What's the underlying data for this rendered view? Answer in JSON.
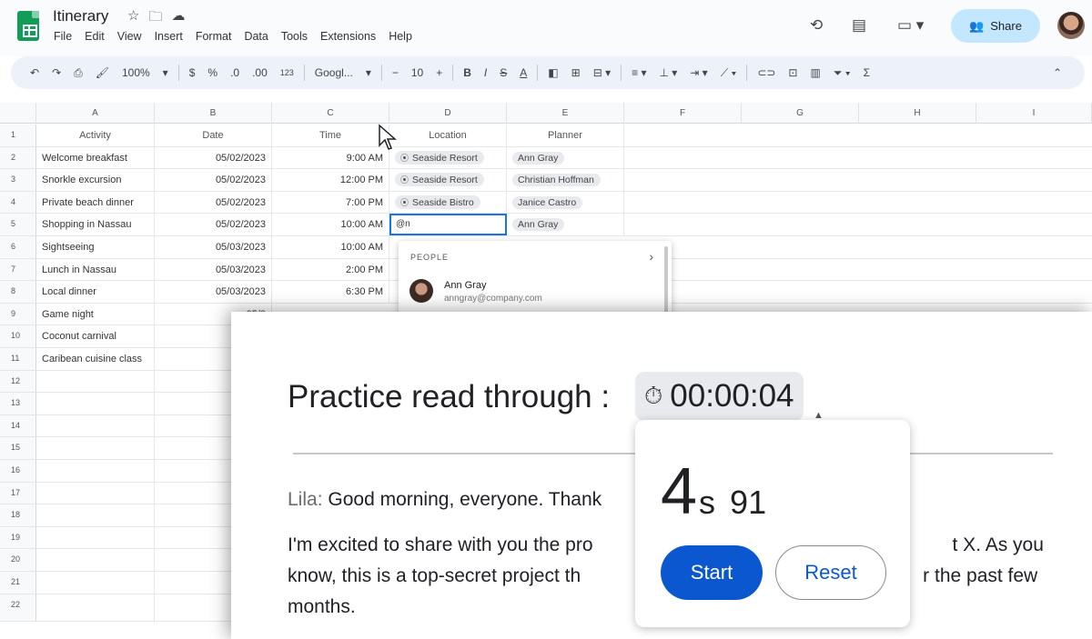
{
  "app": {
    "title": "Itinerary",
    "title_icons": [
      "star-icon",
      "folder-move-icon",
      "cloud-status-icon"
    ],
    "menu": [
      "File",
      "Edit",
      "View",
      "Insert",
      "Format",
      "Data",
      "Tools",
      "Extensions",
      "Help"
    ],
    "share_label": "Share",
    "brand_color": "#0f9d58",
    "share_color": "#c2e7ff"
  },
  "toolbar": {
    "zoom": "100%",
    "currency": "$",
    "percent": "%",
    "decrease_decimal": ".0",
    "increase_decimal": ".00",
    "number_format": "123",
    "font": "Googl...",
    "font_size": "10",
    "minus": "−",
    "plus": "+",
    "bold": "B",
    "italic": "I",
    "strike": "S",
    "text_color": "A",
    "sum": "Σ"
  },
  "sheet": {
    "columns": [
      "A",
      "B",
      "C",
      "D",
      "E",
      "F",
      "G",
      "H",
      "I"
    ],
    "header": {
      "num": "1",
      "activity": "Activity",
      "date": "Date",
      "time": "Time",
      "location": "Location",
      "planner": "Planner"
    },
    "rows": [
      {
        "num": "2",
        "activity": "Welcome breakfast",
        "date": "05/02/2023",
        "time": "9:00 AM",
        "location": "Seaside Resort",
        "planner": "Ann Gray"
      },
      {
        "num": "3",
        "activity": "Snorkle excursion",
        "date": "05/02/2023",
        "time": "12:00 PM",
        "location": "Seaside Resort",
        "planner": "Christian Hoffman"
      },
      {
        "num": "4",
        "activity": "Private beach dinner",
        "date": "05/02/2023",
        "time": "7:00 PM",
        "location": "Seaside Bistro",
        "planner": "Janice Castro"
      },
      {
        "num": "5",
        "activity": "Shopping in Nassau",
        "date": "05/02/2023",
        "time": "10:00 AM",
        "location": "@n",
        "planner": "Ann Gray"
      },
      {
        "num": "6",
        "activity": "Sightseeing",
        "date": "05/03/2023",
        "time": "10:00 AM",
        "location": "",
        "planner": ""
      },
      {
        "num": "7",
        "activity": "Lunch in Nassau",
        "date": "05/03/2023",
        "time": "2:00 PM",
        "location": "",
        "planner": ""
      },
      {
        "num": "8",
        "activity": "Local dinner",
        "date": "05/03/2023",
        "time": "6:30 PM",
        "location": "",
        "planner": ""
      },
      {
        "num": "9",
        "activity": "Game night",
        "date": "05/0",
        "time": "",
        "location": "",
        "planner": ""
      },
      {
        "num": "10",
        "activity": "Coconut carnival",
        "date": "05/0",
        "time": "",
        "location": "",
        "planner": ""
      },
      {
        "num": "11",
        "activity": "Caribean cuisine class",
        "date": "05/0",
        "time": "",
        "location": "",
        "planner": ""
      },
      {
        "num": "12"
      },
      {
        "num": "13"
      },
      {
        "num": "14"
      },
      {
        "num": "15"
      },
      {
        "num": "16"
      },
      {
        "num": "17"
      },
      {
        "num": "18"
      },
      {
        "num": "19"
      },
      {
        "num": "20"
      },
      {
        "num": "21"
      },
      {
        "num": "22"
      }
    ]
  },
  "people_popup": {
    "label": "PEOPLE",
    "name": "Ann Gray",
    "email": "anngray@company.com"
  },
  "practice": {
    "title": "Practice read through :",
    "timer": "00:00:04",
    "speaker": "Lila:",
    "first_line": "Good morning, everyone. Thank",
    "paragraph_a": "I'm excited to share with you the pro",
    "paragraph_b": "t X. As you",
    "paragraph_c": "know, this is a top-secret project th",
    "paragraph_d": "r the past few",
    "paragraph_e": "months."
  },
  "timer_popup": {
    "seconds": "4",
    "unit": "s",
    "hundredths": "91",
    "start_label": "Start",
    "reset_label": "Reset",
    "start_color": "#0b57d0"
  }
}
